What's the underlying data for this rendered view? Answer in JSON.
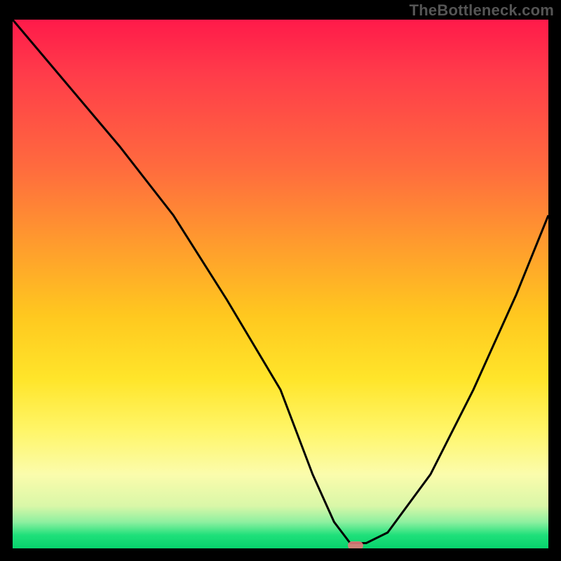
{
  "watermark": "TheBottleneck.com",
  "colors": {
    "curve": "#000000",
    "marker": "#e07a7a",
    "frame": "#000000"
  },
  "chart_data": {
    "type": "line",
    "title": "",
    "xlabel": "",
    "ylabel": "",
    "xlim": [
      0,
      100
    ],
    "ylim": [
      0,
      100
    ],
    "series": [
      {
        "name": "bottleneck-curve",
        "x": [
          0,
          10,
          20,
          30,
          40,
          50,
          56,
          60,
          63,
          66,
          70,
          78,
          86,
          94,
          100
        ],
        "values": [
          100,
          88,
          76,
          63,
          47,
          30,
          14,
          5,
          1,
          1,
          3,
          14,
          30,
          48,
          63
        ]
      }
    ],
    "marker": {
      "x": 64,
      "y": 0.5
    },
    "background_gradient": {
      "top": "#ff1a4a",
      "mid_upper": "#ff9a2e",
      "mid": "#ffe52a",
      "mid_lower": "#fbfcac",
      "bottom": "#07d26c"
    }
  }
}
